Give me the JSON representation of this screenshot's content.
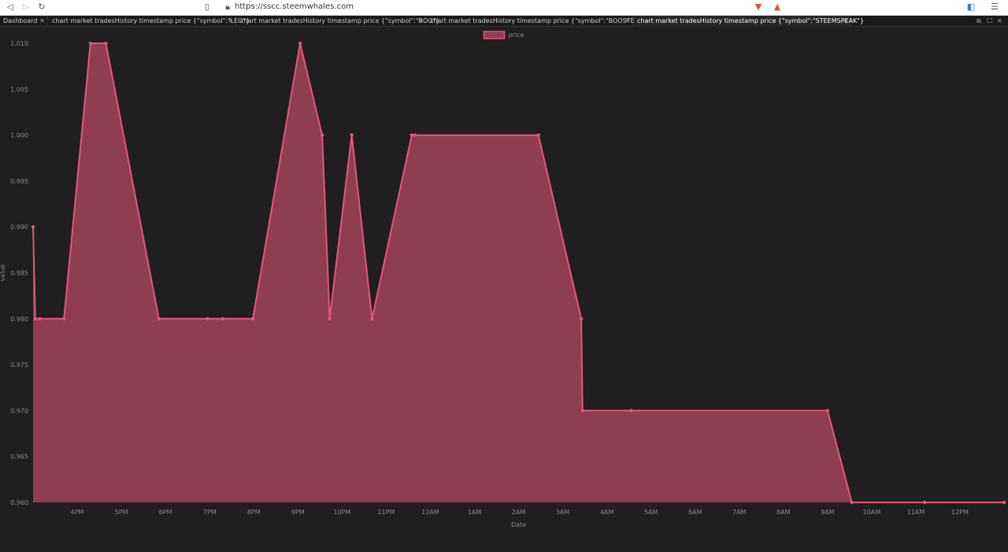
{
  "browser": {
    "url": "https://sscc.steemwhales.com"
  },
  "tabs": [
    {
      "label": "Dashboard",
      "active": false
    },
    {
      "label": "chart market tradesHistory timestamp price {\"symbol\":\"LEO\"}",
      "active": false
    },
    {
      "label": "chart market tradesHistory timestamp price {\"symbol\":\"BOO\"}",
      "active": false
    },
    {
      "label": "chart market tradesHistory timestamp price {\"symbol\":\"BOOSTER\"}",
      "active": false
    },
    {
      "label": "chart market tradesHistory timestamp price {\"symbol\":\"STEEMSPEAK\"}",
      "active": true
    }
  ],
  "chart_data": {
    "type": "area",
    "xlabel": "Date",
    "ylabel": "value",
    "ylim": [
      0.96,
      1.01
    ],
    "yticks": [
      1.01,
      1.005,
      1.0,
      0.995,
      0.99,
      0.985,
      0.98,
      0.975,
      0.97,
      0.965,
      0.96
    ],
    "xlim": [
      15.0,
      37.0
    ],
    "xticks": [
      {
        "x": 16,
        "label": "4PM"
      },
      {
        "x": 17,
        "label": "5PM"
      },
      {
        "x": 18,
        "label": "6PM"
      },
      {
        "x": 19,
        "label": "7PM"
      },
      {
        "x": 20,
        "label": "8PM"
      },
      {
        "x": 21,
        "label": "9PM"
      },
      {
        "x": 22,
        "label": "10PM"
      },
      {
        "x": 23,
        "label": "11PM"
      },
      {
        "x": 24,
        "label": "12AM"
      },
      {
        "x": 25,
        "label": "1AM"
      },
      {
        "x": 26,
        "label": "2AM"
      },
      {
        "x": 27,
        "label": "3AM"
      },
      {
        "x": 28,
        "label": "4AM"
      },
      {
        "x": 29,
        "label": "5AM"
      },
      {
        "x": 30,
        "label": "6AM"
      },
      {
        "x": 31,
        "label": "7AM"
      },
      {
        "x": 32,
        "label": "8AM"
      },
      {
        "x": 33,
        "label": "9AM"
      },
      {
        "x": 34,
        "label": "10AM"
      },
      {
        "x": 35,
        "label": "11AM"
      },
      {
        "x": 36,
        "label": "12PM"
      }
    ],
    "legend_position": "top-center",
    "grid": false,
    "series": [
      {
        "name": "price",
        "color": "#e8557a",
        "fill": "#8f3d52",
        "points": [
          [
            15.0,
            0.99
          ],
          [
            15.05,
            0.98
          ],
          [
            15.15,
            0.98
          ],
          [
            15.7,
            0.98
          ],
          [
            16.3,
            1.01
          ],
          [
            16.65,
            1.01
          ],
          [
            17.85,
            0.98
          ],
          [
            18.95,
            0.98
          ],
          [
            19.3,
            0.98
          ],
          [
            19.98,
            0.98
          ],
          [
            21.05,
            1.01
          ],
          [
            21.55,
            1.0
          ],
          [
            21.72,
            0.98
          ],
          [
            22.22,
            1.0
          ],
          [
            22.68,
            0.98
          ],
          [
            23.58,
            1.0
          ],
          [
            23.65,
            1.0
          ],
          [
            26.45,
            1.0
          ],
          [
            27.42,
            0.98
          ],
          [
            27.45,
            0.97
          ],
          [
            28.55,
            0.97
          ],
          [
            33.0,
            0.97
          ],
          [
            33.55,
            0.96
          ],
          [
            35.2,
            0.96
          ],
          [
            37.0,
            0.96
          ]
        ]
      }
    ]
  }
}
